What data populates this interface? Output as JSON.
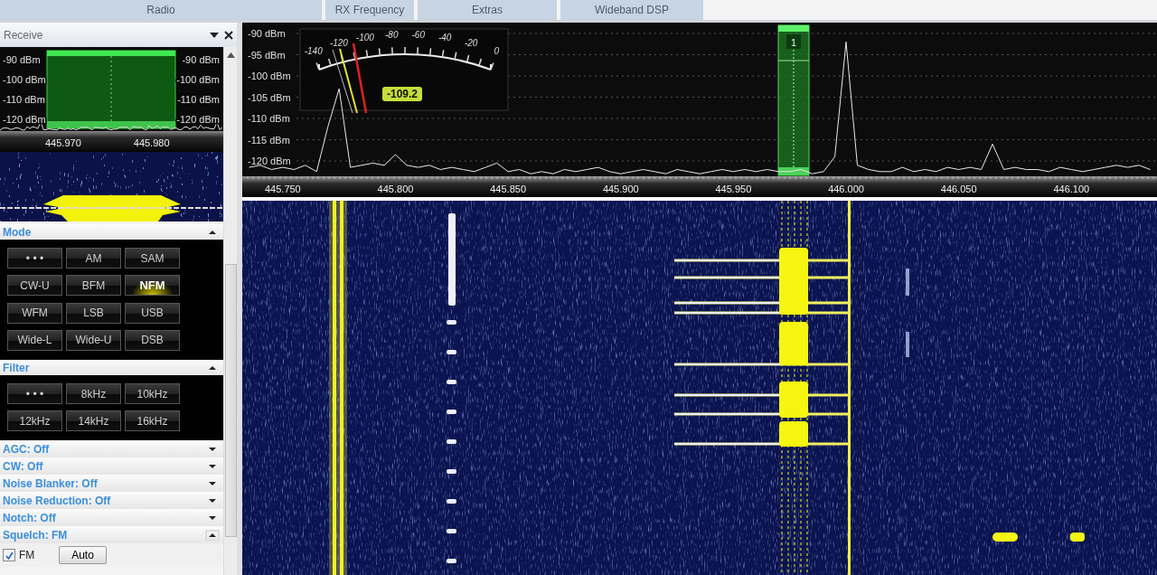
{
  "ribbon_groups": [
    "Radio",
    "RX Frequency",
    "Extras",
    "Wideband DSP"
  ],
  "receive_panel": {
    "title": "Receive",
    "mini_spectrum": {
      "left_labels": [
        "-90 dBm",
        "-100 dBm",
        "-110 dBm",
        "-120 dBm"
      ],
      "right_labels": [
        "-90 dBm",
        "-100 dBm",
        "-110 dBm",
        "-120 dBm"
      ],
      "freq_labels": [
        "445.970",
        "445.980"
      ]
    },
    "mode": {
      "title": "Mode",
      "expanded": true,
      "buttons": [
        {
          "label": "• • •",
          "selected": false
        },
        {
          "label": "AM",
          "selected": false
        },
        {
          "label": "SAM",
          "selected": false
        },
        {
          "label": "CW-U",
          "selected": false
        },
        {
          "label": "BFM",
          "selected": false
        },
        {
          "label": "NFM",
          "selected": true
        },
        {
          "label": "WFM",
          "selected": false
        },
        {
          "label": "LSB",
          "selected": false
        },
        {
          "label": "USB",
          "selected": false
        },
        {
          "label": "Wide-L",
          "selected": false
        },
        {
          "label": "Wide-U",
          "selected": false
        },
        {
          "label": "DSB",
          "selected": false
        }
      ]
    },
    "filter": {
      "title": "Filter",
      "expanded": true,
      "buttons": [
        {
          "label": "• • •",
          "selected": false
        },
        {
          "label": "8kHz",
          "selected": false
        },
        {
          "label": "10kHz",
          "selected": false
        },
        {
          "label": "12kHz",
          "selected": false
        },
        {
          "label": "14kHz",
          "selected": false
        },
        {
          "label": "16kHz",
          "selected": false
        }
      ]
    },
    "sections": [
      {
        "label": "AGC: Off",
        "expanded": false
      },
      {
        "label": "CW: Off",
        "expanded": false
      },
      {
        "label": "Noise Blanker: Off",
        "expanded": false
      },
      {
        "label": "Noise Reduction: Off",
        "expanded": false
      },
      {
        "label": "Notch: Off",
        "expanded": false
      },
      {
        "label": "Squelch: FM",
        "expanded": true
      }
    ],
    "squelch": {
      "fm_checkbox": {
        "label": "FM",
        "checked": true
      },
      "auto_button": "Auto"
    }
  },
  "spectrum": {
    "chart_data": {
      "type": "line",
      "grid": true,
      "ylim": [
        -123.6,
        -87.45
      ],
      "xlim": [
        445.732,
        446.138
      ],
      "yticks": [
        {
          "value": -90,
          "label": "-90 dBm"
        },
        {
          "value": -95,
          "label": "-95 dBm"
        },
        {
          "value": -100,
          "label": "-100 dBm"
        },
        {
          "value": -105,
          "label": "-105 dBm"
        },
        {
          "value": -110,
          "label": "-110 dBm"
        },
        {
          "value": -115,
          "label": "-115 dBm"
        },
        {
          "value": -120,
          "label": "-120 dBm"
        }
      ],
      "xticks": [
        {
          "value": 445.75,
          "label": "445.750"
        },
        {
          "value": 445.8,
          "label": "445.800"
        },
        {
          "value": 445.85,
          "label": "445.850"
        },
        {
          "value": 445.9,
          "label": "445.900"
        },
        {
          "value": 445.95,
          "label": "445.950"
        },
        {
          "value": 446.0,
          "label": "446.000"
        },
        {
          "value": 446.05,
          "label": "446.050"
        },
        {
          "value": 446.1,
          "label": "446.100"
        }
      ],
      "x": [
        445.735,
        445.74,
        445.745,
        445.75,
        445.755,
        445.76,
        445.765,
        445.77,
        445.775,
        445.78,
        445.785,
        445.79,
        445.795,
        445.8,
        445.805,
        445.81,
        445.815,
        445.82,
        445.825,
        445.83,
        445.835,
        445.84,
        445.845,
        445.85,
        445.855,
        445.86,
        445.865,
        445.87,
        445.875,
        445.88,
        445.885,
        445.89,
        445.895,
        445.9,
        445.905,
        445.91,
        445.915,
        445.92,
        445.925,
        445.93,
        445.935,
        445.94,
        445.945,
        445.95,
        445.955,
        445.96,
        445.965,
        445.97,
        445.975,
        445.98,
        445.985,
        445.99,
        445.995,
        446.0,
        446.005,
        446.01,
        446.015,
        446.02,
        446.025,
        446.03,
        446.035,
        446.04,
        446.045,
        446.05,
        446.055,
        446.06,
        446.065,
        446.07,
        446.075,
        446.08,
        446.085,
        446.09,
        446.095,
        446.1,
        446.105,
        446.11,
        446.115,
        446.12,
        446.125,
        446.13,
        446.135
      ],
      "series": [
        {
          "color": "#e8e8e8",
          "values": [
            -121.5,
            -121,
            -122,
            -121.5,
            -122,
            -121,
            -122.5,
            -112,
            -103,
            -121.5,
            -121,
            -120.5,
            -121,
            -118.5,
            -121,
            -121.5,
            -121,
            -122,
            -121.5,
            -122,
            -122.5,
            -121.5,
            -120.5,
            -122.5,
            -122,
            -123,
            -122.5,
            -123,
            -122,
            -122.5,
            -122,
            -121.5,
            -122.5,
            -123,
            -122.5,
            -122,
            -122.5,
            -123,
            -122,
            -122.5,
            -123,
            -122.5,
            -122,
            -122.5,
            -122,
            -122.5,
            -122,
            -122.5,
            -122.5,
            -122,
            -123,
            -122.5,
            -119,
            -92,
            -121,
            -122,
            -122.5,
            -122.5,
            -121.5,
            -122.5,
            -122,
            -122.5,
            -121.5,
            -122,
            -121.5,
            -122,
            -116,
            -122,
            -121.5,
            -122,
            -122,
            -122.5,
            -121.5,
            -122,
            -122.5,
            -122,
            -121.5,
            -121,
            -121.5,
            -121,
            -122
          ]
        }
      ]
    },
    "meter": {
      "scale": [
        "-140",
        "-120",
        "-100",
        "-80",
        "-60",
        "-40",
        "-20",
        "0"
      ],
      "reading": "-109.2"
    },
    "vfo_marker": "1"
  }
}
